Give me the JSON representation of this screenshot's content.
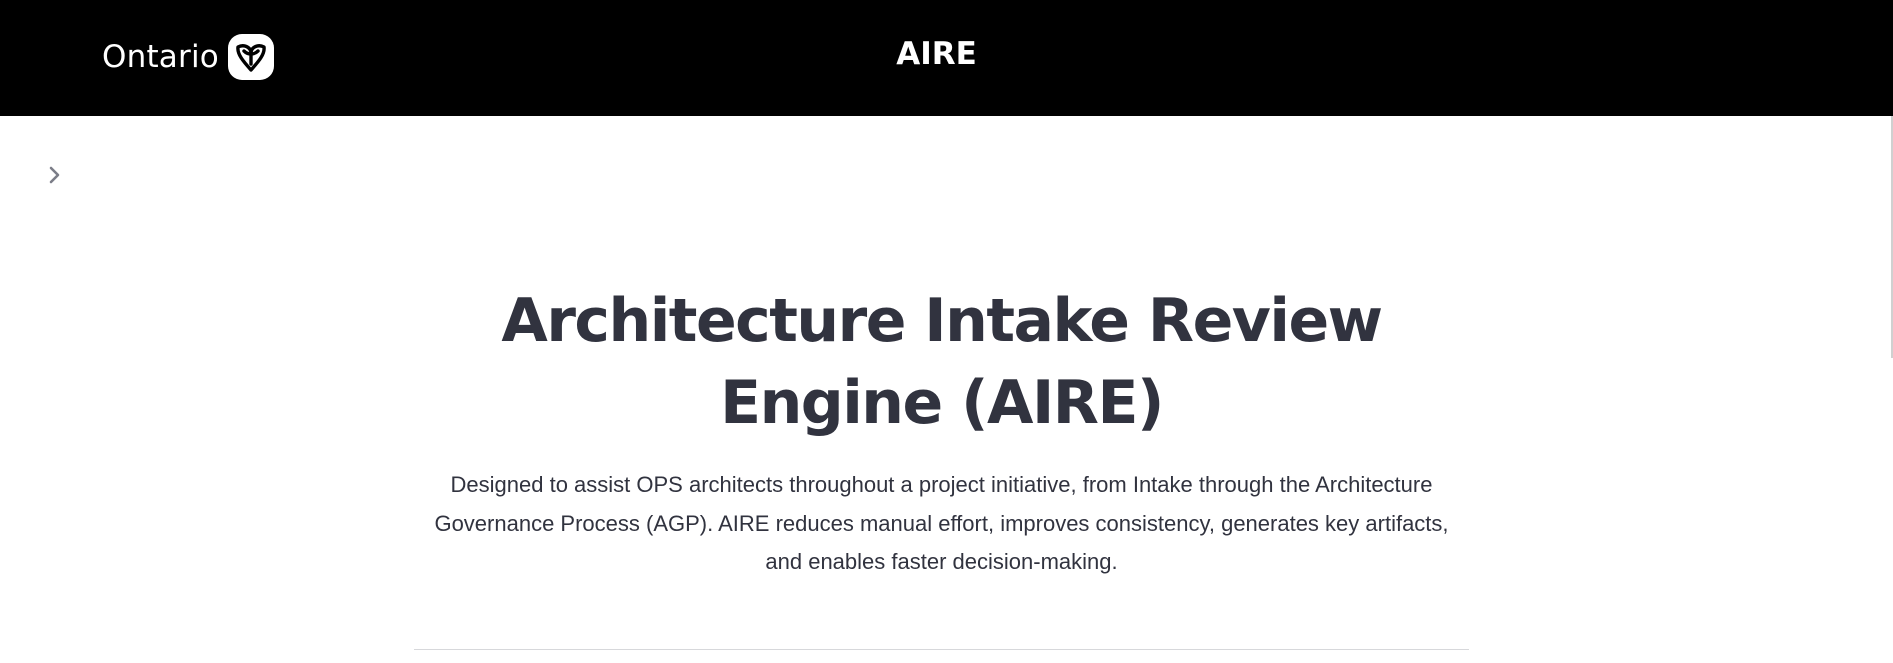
{
  "header": {
    "brand_text": "Ontario",
    "logo_icon": "ontario-trillium-icon",
    "app_title": "AIRE",
    "background_color": "#000000",
    "text_color": "#ffffff"
  },
  "sidebar": {
    "toggle_icon": "chevron-right-icon"
  },
  "main": {
    "title": "Architecture Intake Review Engine (AIRE)",
    "description": "Designed to assist OPS architects throughout a project initiative, from Intake through the Architecture Governance Process (AGP). AIRE reduces manual effort, improves consistency, generates key artifacts, and enables faster decision-making.",
    "text_color": "#31333f"
  }
}
